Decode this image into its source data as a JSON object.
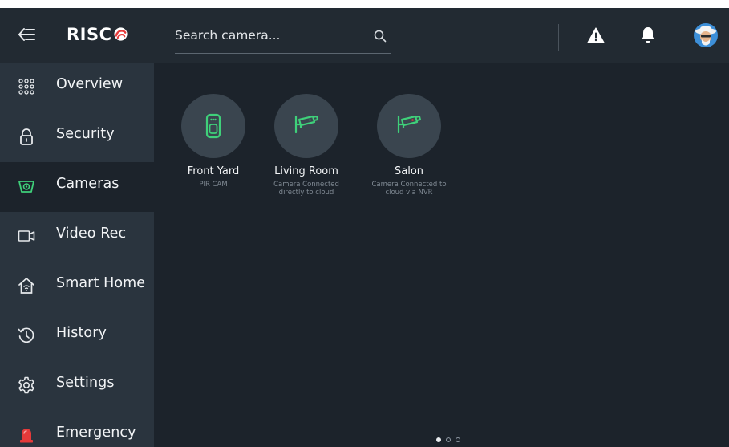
{
  "brand": {
    "name": "RISC"
  },
  "search": {
    "placeholder": "Search camera..."
  },
  "sidebar": {
    "items": [
      {
        "label": "Overview",
        "icon": "grid-dots-icon"
      },
      {
        "label": "Security",
        "icon": "padlock-icon"
      },
      {
        "label": "Cameras",
        "icon": "camera-icon",
        "active": true
      },
      {
        "label": "Video Rec",
        "icon": "video-rec-icon"
      },
      {
        "label": "Smart Home",
        "icon": "smart-home-icon"
      },
      {
        "label": "History",
        "icon": "history-icon"
      },
      {
        "label": "Settings",
        "icon": "gear-icon"
      },
      {
        "label": "Emergency",
        "icon": "siren-icon"
      }
    ]
  },
  "devices": [
    {
      "name": "Front Yard",
      "desc": "PIR CAM",
      "icon": "pir-camera-icon"
    },
    {
      "name": "Living Room",
      "desc": "Camera Connected directly to cloud",
      "icon": "cctv-camera-icon"
    },
    {
      "name": "Salon",
      "desc": "Camera Connected to cloud via NVR",
      "icon": "cctv-camera-icon"
    }
  ],
  "pagination": {
    "current": 1,
    "total": 3
  },
  "colors": {
    "accent_green": "#3fd07a",
    "emergency_red": "#e53a3a",
    "background": "#1c232b",
    "sidebar": "#2a343e",
    "topbar": "#222a32"
  }
}
